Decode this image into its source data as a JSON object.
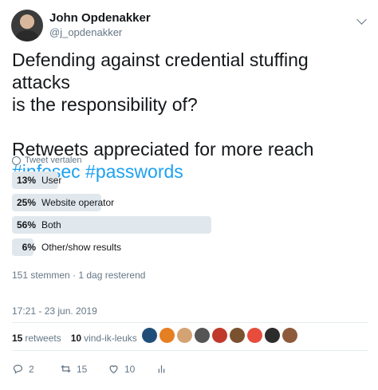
{
  "author": {
    "name": "John Opdenakker",
    "handle": "@j_opdenakker",
    "avatar_icon": "avatar-photo"
  },
  "tweet": {
    "line1": "Defending against credential stuffing attacks",
    "line2": "is the responsibility of?",
    "line3": "Retweets appreciated for more reach",
    "hashtags": "#infosec #passwords"
  },
  "translate_label": "Tweet vertalen",
  "poll": {
    "options": [
      {
        "percent": "13%",
        "label": "User",
        "fraction": 0.13
      },
      {
        "percent": "25%",
        "label": "Website operator",
        "fraction": 0.25
      },
      {
        "percent": "56%",
        "label": "Both",
        "fraction": 0.56
      },
      {
        "percent": "6%",
        "label": "Other/show results",
        "fraction": 0.06
      }
    ],
    "meta": "151 stemmen · 1 dag resterend"
  },
  "timestamp": "17:21 - 23 jun. 2019",
  "stats": {
    "retweets_count": "15",
    "retweets_label": "retweets",
    "likes_count": "10",
    "likes_label": "vind-ik-leuks"
  },
  "likers": [
    "#1f4e79",
    "#e67e22",
    "#d4a373",
    "#555555",
    "#c0392b",
    "#7a5230",
    "#e74c3c",
    "#2c2c2c",
    "#8e5a3b"
  ],
  "actions": {
    "reply_count": "2",
    "retweet_count": "15",
    "like_count": "10"
  },
  "colors": {
    "accent": "#1da1f2",
    "poll_bar": "#e1e8ed",
    "muted": "#657786"
  }
}
